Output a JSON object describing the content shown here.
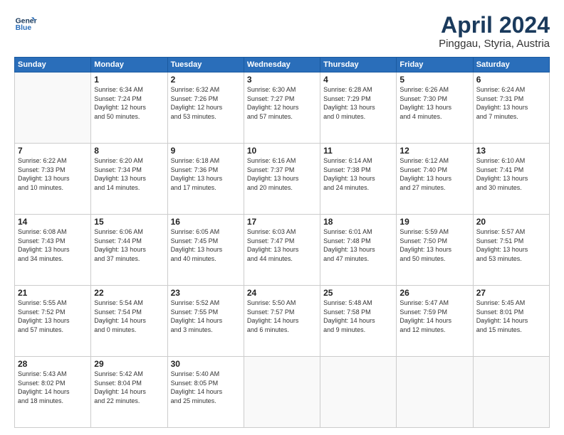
{
  "header": {
    "logo_line1": "General",
    "logo_line2": "Blue",
    "title": "April 2024",
    "subtitle": "Pinggau, Styria, Austria"
  },
  "weekdays": [
    "Sunday",
    "Monday",
    "Tuesday",
    "Wednesday",
    "Thursday",
    "Friday",
    "Saturday"
  ],
  "weeks": [
    [
      {
        "day": "",
        "info": ""
      },
      {
        "day": "1",
        "info": "Sunrise: 6:34 AM\nSunset: 7:24 PM\nDaylight: 12 hours\nand 50 minutes."
      },
      {
        "day": "2",
        "info": "Sunrise: 6:32 AM\nSunset: 7:26 PM\nDaylight: 12 hours\nand 53 minutes."
      },
      {
        "day": "3",
        "info": "Sunrise: 6:30 AM\nSunset: 7:27 PM\nDaylight: 12 hours\nand 57 minutes."
      },
      {
        "day": "4",
        "info": "Sunrise: 6:28 AM\nSunset: 7:29 PM\nDaylight: 13 hours\nand 0 minutes."
      },
      {
        "day": "5",
        "info": "Sunrise: 6:26 AM\nSunset: 7:30 PM\nDaylight: 13 hours\nand 4 minutes."
      },
      {
        "day": "6",
        "info": "Sunrise: 6:24 AM\nSunset: 7:31 PM\nDaylight: 13 hours\nand 7 minutes."
      }
    ],
    [
      {
        "day": "7",
        "info": "Sunrise: 6:22 AM\nSunset: 7:33 PM\nDaylight: 13 hours\nand 10 minutes."
      },
      {
        "day": "8",
        "info": "Sunrise: 6:20 AM\nSunset: 7:34 PM\nDaylight: 13 hours\nand 14 minutes."
      },
      {
        "day": "9",
        "info": "Sunrise: 6:18 AM\nSunset: 7:36 PM\nDaylight: 13 hours\nand 17 minutes."
      },
      {
        "day": "10",
        "info": "Sunrise: 6:16 AM\nSunset: 7:37 PM\nDaylight: 13 hours\nand 20 minutes."
      },
      {
        "day": "11",
        "info": "Sunrise: 6:14 AM\nSunset: 7:38 PM\nDaylight: 13 hours\nand 24 minutes."
      },
      {
        "day": "12",
        "info": "Sunrise: 6:12 AM\nSunset: 7:40 PM\nDaylight: 13 hours\nand 27 minutes."
      },
      {
        "day": "13",
        "info": "Sunrise: 6:10 AM\nSunset: 7:41 PM\nDaylight: 13 hours\nand 30 minutes."
      }
    ],
    [
      {
        "day": "14",
        "info": "Sunrise: 6:08 AM\nSunset: 7:43 PM\nDaylight: 13 hours\nand 34 minutes."
      },
      {
        "day": "15",
        "info": "Sunrise: 6:06 AM\nSunset: 7:44 PM\nDaylight: 13 hours\nand 37 minutes."
      },
      {
        "day": "16",
        "info": "Sunrise: 6:05 AM\nSunset: 7:45 PM\nDaylight: 13 hours\nand 40 minutes."
      },
      {
        "day": "17",
        "info": "Sunrise: 6:03 AM\nSunset: 7:47 PM\nDaylight: 13 hours\nand 44 minutes."
      },
      {
        "day": "18",
        "info": "Sunrise: 6:01 AM\nSunset: 7:48 PM\nDaylight: 13 hours\nand 47 minutes."
      },
      {
        "day": "19",
        "info": "Sunrise: 5:59 AM\nSunset: 7:50 PM\nDaylight: 13 hours\nand 50 minutes."
      },
      {
        "day": "20",
        "info": "Sunrise: 5:57 AM\nSunset: 7:51 PM\nDaylight: 13 hours\nand 53 minutes."
      }
    ],
    [
      {
        "day": "21",
        "info": "Sunrise: 5:55 AM\nSunset: 7:52 PM\nDaylight: 13 hours\nand 57 minutes."
      },
      {
        "day": "22",
        "info": "Sunrise: 5:54 AM\nSunset: 7:54 PM\nDaylight: 14 hours\nand 0 minutes."
      },
      {
        "day": "23",
        "info": "Sunrise: 5:52 AM\nSunset: 7:55 PM\nDaylight: 14 hours\nand 3 minutes."
      },
      {
        "day": "24",
        "info": "Sunrise: 5:50 AM\nSunset: 7:57 PM\nDaylight: 14 hours\nand 6 minutes."
      },
      {
        "day": "25",
        "info": "Sunrise: 5:48 AM\nSunset: 7:58 PM\nDaylight: 14 hours\nand 9 minutes."
      },
      {
        "day": "26",
        "info": "Sunrise: 5:47 AM\nSunset: 7:59 PM\nDaylight: 14 hours\nand 12 minutes."
      },
      {
        "day": "27",
        "info": "Sunrise: 5:45 AM\nSunset: 8:01 PM\nDaylight: 14 hours\nand 15 minutes."
      }
    ],
    [
      {
        "day": "28",
        "info": "Sunrise: 5:43 AM\nSunset: 8:02 PM\nDaylight: 14 hours\nand 18 minutes."
      },
      {
        "day": "29",
        "info": "Sunrise: 5:42 AM\nSunset: 8:04 PM\nDaylight: 14 hours\nand 22 minutes."
      },
      {
        "day": "30",
        "info": "Sunrise: 5:40 AM\nSunset: 8:05 PM\nDaylight: 14 hours\nand 25 minutes."
      },
      {
        "day": "",
        "info": ""
      },
      {
        "day": "",
        "info": ""
      },
      {
        "day": "",
        "info": ""
      },
      {
        "day": "",
        "info": ""
      }
    ]
  ]
}
